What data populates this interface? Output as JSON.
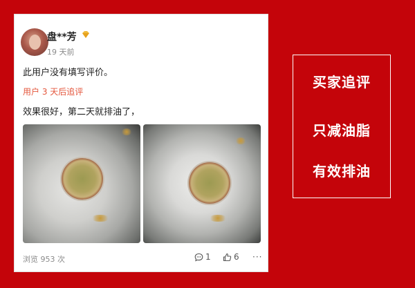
{
  "review_card": {
    "username": "盘**芳",
    "time_ago": "19 天前",
    "review_text": "此用户没有填写评价。",
    "followup_label": "用户 3 天后追评",
    "followup_text": "效果很好，第二天就排油了，",
    "views": "浏览 953 次",
    "comment_count": "1",
    "like_count": "6",
    "more_label": "···"
  },
  "banner": {
    "line1": "买家追评",
    "line2": "只减油脂",
    "line3": "有效排油"
  },
  "colors": {
    "background": "#c4040a",
    "followup_accent": "#e4573d",
    "vip_badge": "#f0b93a"
  },
  "icons": {
    "vip": "diamond-vip-icon",
    "comment": "comment-bubble-icon",
    "like": "thumb-up-icon"
  }
}
